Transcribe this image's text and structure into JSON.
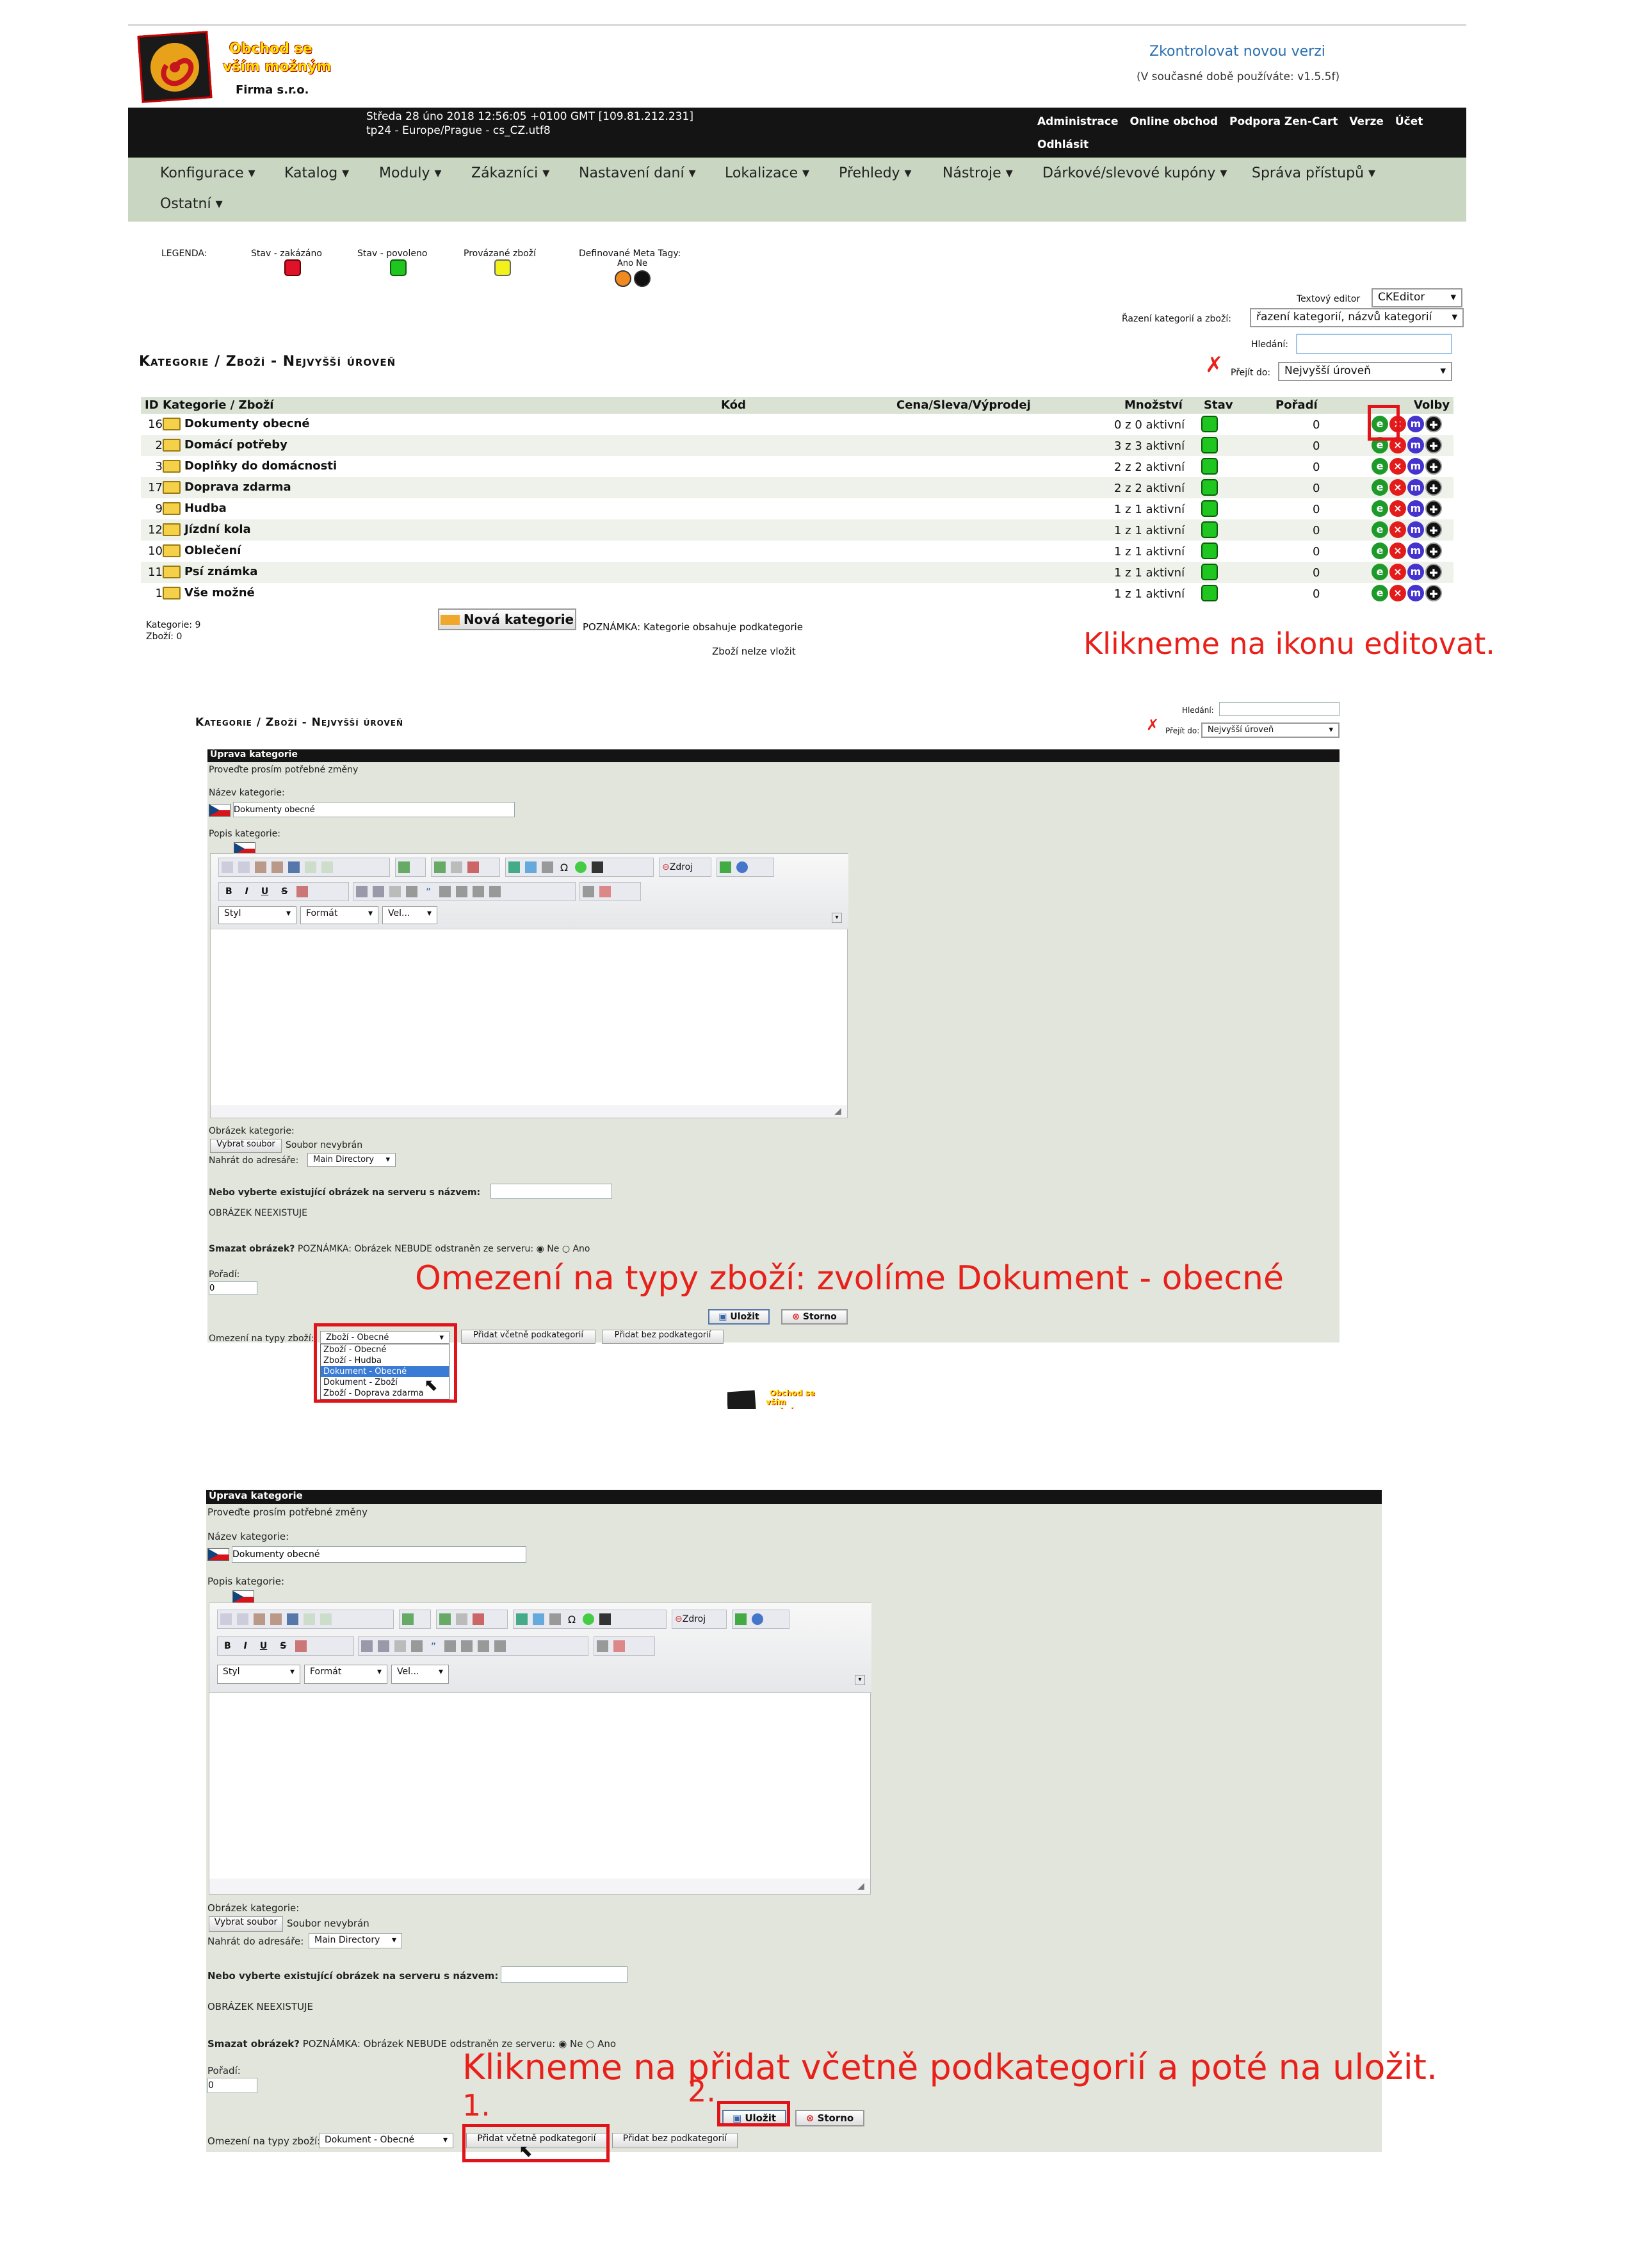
{
  "logo": {
    "line1": "Obchod se",
    "line2": "vším možným",
    "company": "Firma s.r.o."
  },
  "header": {
    "check_version": "Zkontrolovat novou verzi",
    "current_version": "(V současné době používáte: v1.5.5f)"
  },
  "blackbar": {
    "datetime": "Středa 28 úno 2018 12:56:05 +0100 GMT [109.81.212.231]",
    "locale": "tp24 - Europe/Prague - cs_CZ.utf8",
    "links": [
      "Administrace",
      "Online obchod",
      "Podpora Zen-Cart",
      "Verze",
      "Účet"
    ],
    "logout": "Odhlásit"
  },
  "menu": [
    "Konfigurace",
    "Katalog",
    "Moduly",
    "Zákazníci",
    "Nastavení daní",
    "Lokalizace",
    "Přehledy",
    "Nástroje",
    "Dárkové/slevové kupóny",
    "Správa přístupů",
    "Ostatní"
  ],
  "legend": {
    "label": "LEGENDA:",
    "disabled": "Stav - zakázáno",
    "enabled": "Stav - povoleno",
    "linked": "Provázané zboží",
    "meta": "Definované Meta Tagy:",
    "meta_yes_no": "Ano Ne"
  },
  "controls": {
    "editor_label": "Textový editor",
    "editor_value": "CKEditor",
    "sort_label": "Řazení kategorií a zboží:",
    "sort_value": "řazení kategorií, názvů kategorií",
    "search_label": "Hledání:",
    "goto_label": "Přejít do:",
    "goto_value": "Nejvyšší úroveň"
  },
  "page_title": "Kategorie / Zboží - Nejvyšší úroveň",
  "table": {
    "headers": {
      "id": "ID",
      "name": "Kategorie / Zboží",
      "code": "Kód",
      "price": "Cena/Sleva/Výprodej",
      "qty": "Množství",
      "status": "Stav",
      "order": "Pořadí",
      "options": "Volby"
    },
    "rows": [
      {
        "id": "16",
        "name": "Dokumenty obecné",
        "qty": "0 z 0 aktivní",
        "order": "0"
      },
      {
        "id": "2",
        "name": "Domácí potřeby",
        "qty": "3 z 3 aktivní",
        "order": "0"
      },
      {
        "id": "3",
        "name": "Doplňky do domácnosti",
        "qty": "2 z 2 aktivní",
        "order": "0"
      },
      {
        "id": "17",
        "name": "Doprava zdarma",
        "qty": "2 z 2 aktivní",
        "order": "0"
      },
      {
        "id": "9",
        "name": "Hudba",
        "qty": "1 z 1 aktivní",
        "order": "0"
      },
      {
        "id": "12",
        "name": "Jízdní kola",
        "qty": "1 z 1 aktivní",
        "order": "0"
      },
      {
        "id": "10",
        "name": "Oblečení",
        "qty": "1 z 1 aktivní",
        "order": "0"
      },
      {
        "id": "11",
        "name": "Psí známka",
        "qty": "1 z 1 aktivní",
        "order": "0"
      },
      {
        "id": "1",
        "name": "Vše možné",
        "qty": "1 z 1 aktivní",
        "order": "0"
      }
    ]
  },
  "footer_counts": {
    "categories": "Kategorie: 9",
    "products": "Zboží: 0"
  },
  "new_category": "Nová kategorie",
  "note_subcats": "POZNÁMKA: Kategorie obsahuje podkategorie",
  "note_noproducts": "Zboží nelze vložit",
  "instructions": {
    "step1": "Klikneme na ikonu editovat.",
    "step2": "Omezení na typy zboží: zvolíme Dokument - obecné",
    "step3": "Klikneme na přidat včetně podkategorií a poté na uložit.",
    "num1": "1.",
    "num2": "2."
  },
  "edit": {
    "title": "Úprava kategorie",
    "subtitle": "Proveďte prosím potřebné změny",
    "name_label": "Název kategorie:",
    "name_value": "Dokumenty obecné",
    "desc_label": "Popis kategorie:",
    "source": "Zdroj",
    "style": "Styl",
    "format": "Formát",
    "size": "Vel...",
    "image_label": "Obrázek kategorie:",
    "choose_file": "Vybrat soubor",
    "no_file": "Soubor nevybrán",
    "upload_dir_label": "Nahrát do adresáře:",
    "upload_dir_value": "Main Directory",
    "existing_label": "Nebo vyberte existující obrázek na serveru s názvem:",
    "no_image": "OBRÁZEK NEEXISTUJE",
    "delete_label": "Smazat obrázek?",
    "delete_note": "POZNÁMKA: Obrázek NEBUDE odstraněn ze serveru:",
    "no": "Ne",
    "yes": "Ano",
    "order_label": "Pořadí:",
    "order_value": "0",
    "save": "Uložit",
    "cancel": "Storno",
    "restrict_label": "Omezení na typy zboží:",
    "restrict_value_1": "Zboží - Obecné",
    "restrict_value_2": "Dokument - Obecné",
    "add_with_sub": "Přidat včetně podkategorií",
    "add_without_sub": "Přidat bez podkategorií",
    "options": [
      "Zboží - Obecné",
      "Zboží - Hudba",
      "Dokument - Obecné",
      "Dokument - Zboží",
      "Zboží - Doprava zdarma"
    ]
  }
}
